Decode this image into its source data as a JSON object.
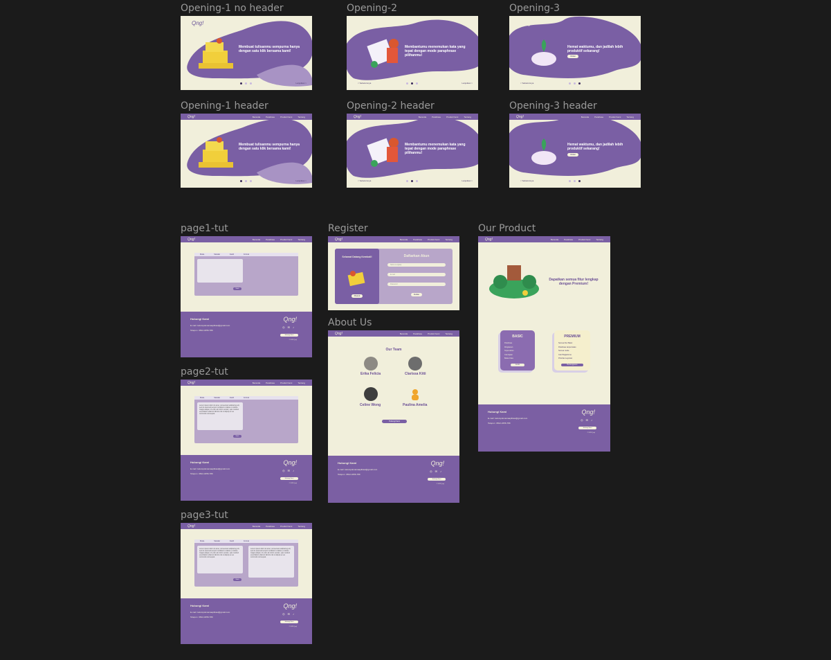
{
  "frames": {
    "opening1_no_header": {
      "label": "Opening-1 no header",
      "tagline": "Membuat tulisanmu sempurna hanya dengan satu klik bersama kami!",
      "next": "Lanjutkan >"
    },
    "opening2": {
      "label": "Opening-2",
      "tagline": "Membantumu menemukan kata yang tepat dengan mode paraphrase pilihanmu!",
      "next": "Lanjutkan >",
      "prev": "< Sebelumnya"
    },
    "opening3": {
      "label": "Opening-3",
      "tagline": "Hemat waktumu, dan jadilah lebih produktif sekarang!",
      "cta": "Mulai",
      "prev": "< Sebelumnya"
    },
    "opening1_header": {
      "label": "Opening-1 header",
      "tagline": "Membuat tulisanmu sempurna hanya dengan satu klik bersama kami!",
      "next": "Lanjutkan >"
    },
    "opening2_header": {
      "label": "Opening-2 header",
      "tagline": "Membantumu menemukan kata yang tepat dengan mode paraphrase pilihanmu!",
      "next": "Lanjutkan >",
      "prev": "< Sebelumnya"
    },
    "opening3_header": {
      "label": "Opening-3 header",
      "tagline": "Hemat waktumu, dan jadilah lebih produktif sekarang!",
      "cta": "Mulai",
      "prev": "< Sebelumnya"
    },
    "page1_tut": {
      "label": "page1-tut"
    },
    "page2_tut": {
      "label": "page2-tut"
    },
    "page3_tut": {
      "label": "page3-tut"
    },
    "register": {
      "label": "Register",
      "welcome": "Selamat Datang Kembali!",
      "heading": "Daftarkan Akun",
      "login": "Masuk",
      "submit": "Daftar"
    },
    "about": {
      "label": "About Us",
      "heading": "Our Team",
      "button": "Hubungi Kami"
    },
    "product": {
      "label": "Our Product",
      "headline": "Dapatkan semua fitur lengkap dengan Premium!",
      "basic": "BASIC",
      "premium": "PREMIUM",
      "basic_btn": "Gratis",
      "premium_btn": "Berlangganan"
    }
  },
  "logo": "Qng!",
  "nav": [
    "Beranda",
    "Parafrase",
    "Produk Kami",
    "Tentang"
  ],
  "tut_tabs": [
    "Mode",
    "Standar",
    "Fasih",
    "Formal"
  ],
  "tut_btn": "Ubah",
  "tut_text": "Lorem ipsum dolor sit amet, consectetur adipiscing elit, sed do eiusmod tempor incididunt ut labore et dolore magna aliqua. Ut enim ad minim veniam, quis nostrud exercitation ullamco laboris nisi ut aliquip ex ea commodo consequat.",
  "footer": {
    "title": "Hubungi Kami",
    "email_label": "E-mail",
    "email": "kelompoknamaaplikasi@gmail.com",
    "phone_label": "Telepon",
    "phone": "0812-3456-789",
    "button": "Hubungi Kami",
    "copy": "© 2023 Qng!"
  },
  "team": [
    "Erika Felicia",
    "Clarissa Kitti",
    "Celine Wong",
    "Paulina Amelia"
  ],
  "register_inputs": [
    "Nama Lengkap",
    "E-mail",
    "Password"
  ],
  "basic_items": [
    "Parafrase",
    "Ringkasan",
    "Terjemahan",
    "Cek Ejaan",
    "Batas Kata"
  ],
  "premium_items": [
    "Semua fitur Basic",
    "Parafrase tanpa batas",
    "Semua mode",
    "Cek Plagiarisme",
    "Prioritas Layanan"
  ],
  "colors": {
    "purple": "#7a5fa4",
    "cream": "#f1efdb",
    "dark": "#1b1b1b"
  }
}
